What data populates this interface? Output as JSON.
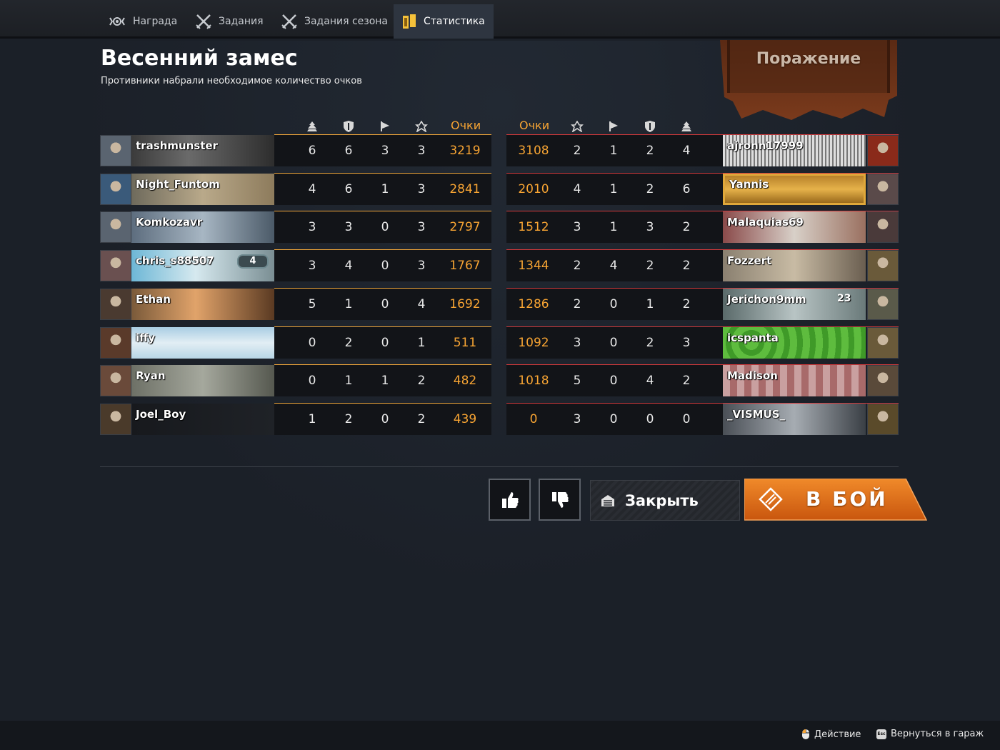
{
  "tabs": [
    {
      "label": "Награда",
      "icon": "reward-icon",
      "active": false
    },
    {
      "label": "Задания",
      "icon": "crossed-swords-icon",
      "active": false
    },
    {
      "label": "Задания сезона",
      "icon": "crossed-swords-icon",
      "active": false
    },
    {
      "label": "Статистика",
      "icon": "stats-book-icon",
      "active": true
    }
  ],
  "match": {
    "title": "Весенний замес",
    "subtitle": "Противники набрали необходимое количество очков",
    "result": "Поражение"
  },
  "columns": {
    "score_label": "Очки",
    "left_order": [
      "kills-icon",
      "shield-icon",
      "flag-icon",
      "assist-icon"
    ],
    "right_order": [
      "assist-icon",
      "flag-icon",
      "shield-icon",
      "kills-icon"
    ]
  },
  "colors": {
    "accent": "#f7a433",
    "ally_line": "#f0a63a",
    "enemy_line": "#d2393b",
    "fight_button": "#e8731a"
  },
  "team_left": [
    {
      "name": "trashmunster",
      "stats": [
        "6",
        "6",
        "3",
        "3"
      ],
      "score": "3219"
    },
    {
      "name": "Night_Funtom",
      "stats": [
        "4",
        "6",
        "1",
        "3"
      ],
      "score": "2841"
    },
    {
      "name": "Komkozavr",
      "stats": [
        "3",
        "3",
        "0",
        "3"
      ],
      "score": "2797"
    },
    {
      "name": "chris_s88507",
      "badge": "4",
      "stats": [
        "3",
        "4",
        "0",
        "3"
      ],
      "score": "1767"
    },
    {
      "name": "Ethan",
      "stats": [
        "5",
        "1",
        "0",
        "4"
      ],
      "score": "1692"
    },
    {
      "name": "iffy",
      "stats": [
        "0",
        "2",
        "0",
        "1"
      ],
      "score": "511"
    },
    {
      "name": "Ryan",
      "stats": [
        "0",
        "1",
        "1",
        "2"
      ],
      "score": "482"
    },
    {
      "name": "Joel_Boy",
      "stats": [
        "1",
        "2",
        "0",
        "2"
      ],
      "score": "439"
    }
  ],
  "team_right": [
    {
      "name": "ajronn17999",
      "score": "3108",
      "stats": [
        "2",
        "1",
        "2",
        "4"
      ]
    },
    {
      "name": "Yannis",
      "score": "2010",
      "stats": [
        "4",
        "1",
        "2",
        "6"
      ]
    },
    {
      "name": "Malaquias69",
      "score": "1512",
      "stats": [
        "3",
        "1",
        "3",
        "2"
      ]
    },
    {
      "name": "Fozzert",
      "score": "1344",
      "stats": [
        "2",
        "4",
        "2",
        "2"
      ]
    },
    {
      "name": "Jerichon9mm",
      "plate_num": "23",
      "score": "1286",
      "stats": [
        "2",
        "0",
        "1",
        "2"
      ]
    },
    {
      "name": "icspanta",
      "score": "1092",
      "stats": [
        "3",
        "0",
        "2",
        "3"
      ]
    },
    {
      "name": "Madison",
      "score": "1018",
      "stats": [
        "5",
        "0",
        "4",
        "2"
      ]
    },
    {
      "name": "_VISMUS_",
      "score": "0",
      "stats": [
        "3",
        "0",
        "0",
        "0"
      ]
    }
  ],
  "buttons": {
    "like": "thumbs-up-icon",
    "dislike": "thumbs-down-icon",
    "close": "Закрыть",
    "fight": "В БОЙ"
  },
  "footer": {
    "action": "Действие",
    "action_key": "mouse-icon",
    "back": "Вернуться в гараж",
    "back_key": "Esc"
  }
}
